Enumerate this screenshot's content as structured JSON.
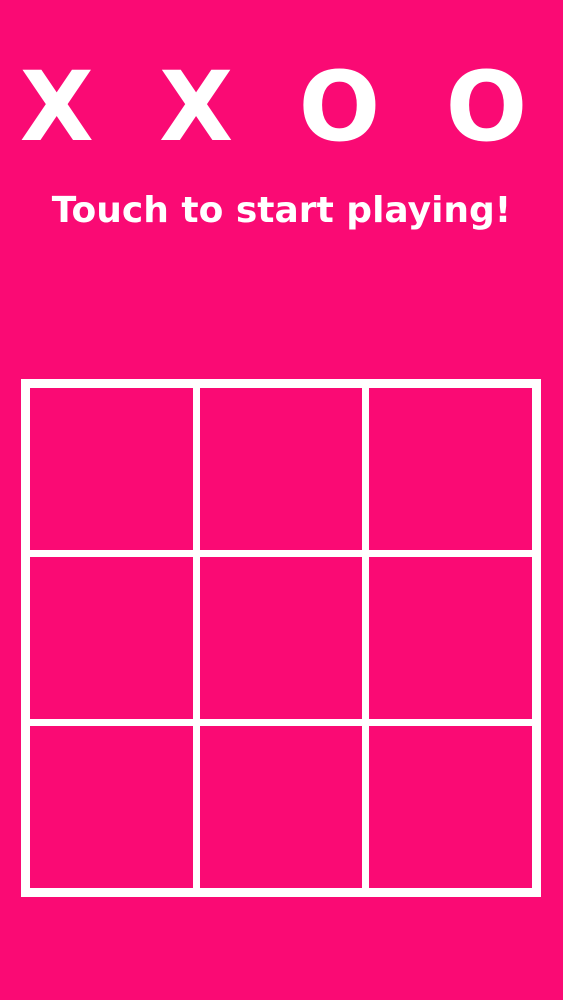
{
  "game": {
    "title": "X X O O",
    "subtitle": "Touch to start playing!"
  },
  "board": {
    "rows": 3,
    "cols": 3,
    "cells": [
      "",
      "",
      "",
      "",
      "",
      "",
      "",
      "",
      ""
    ]
  },
  "colors": {
    "background": "#fa0a74",
    "foreground": "#ffffff"
  }
}
